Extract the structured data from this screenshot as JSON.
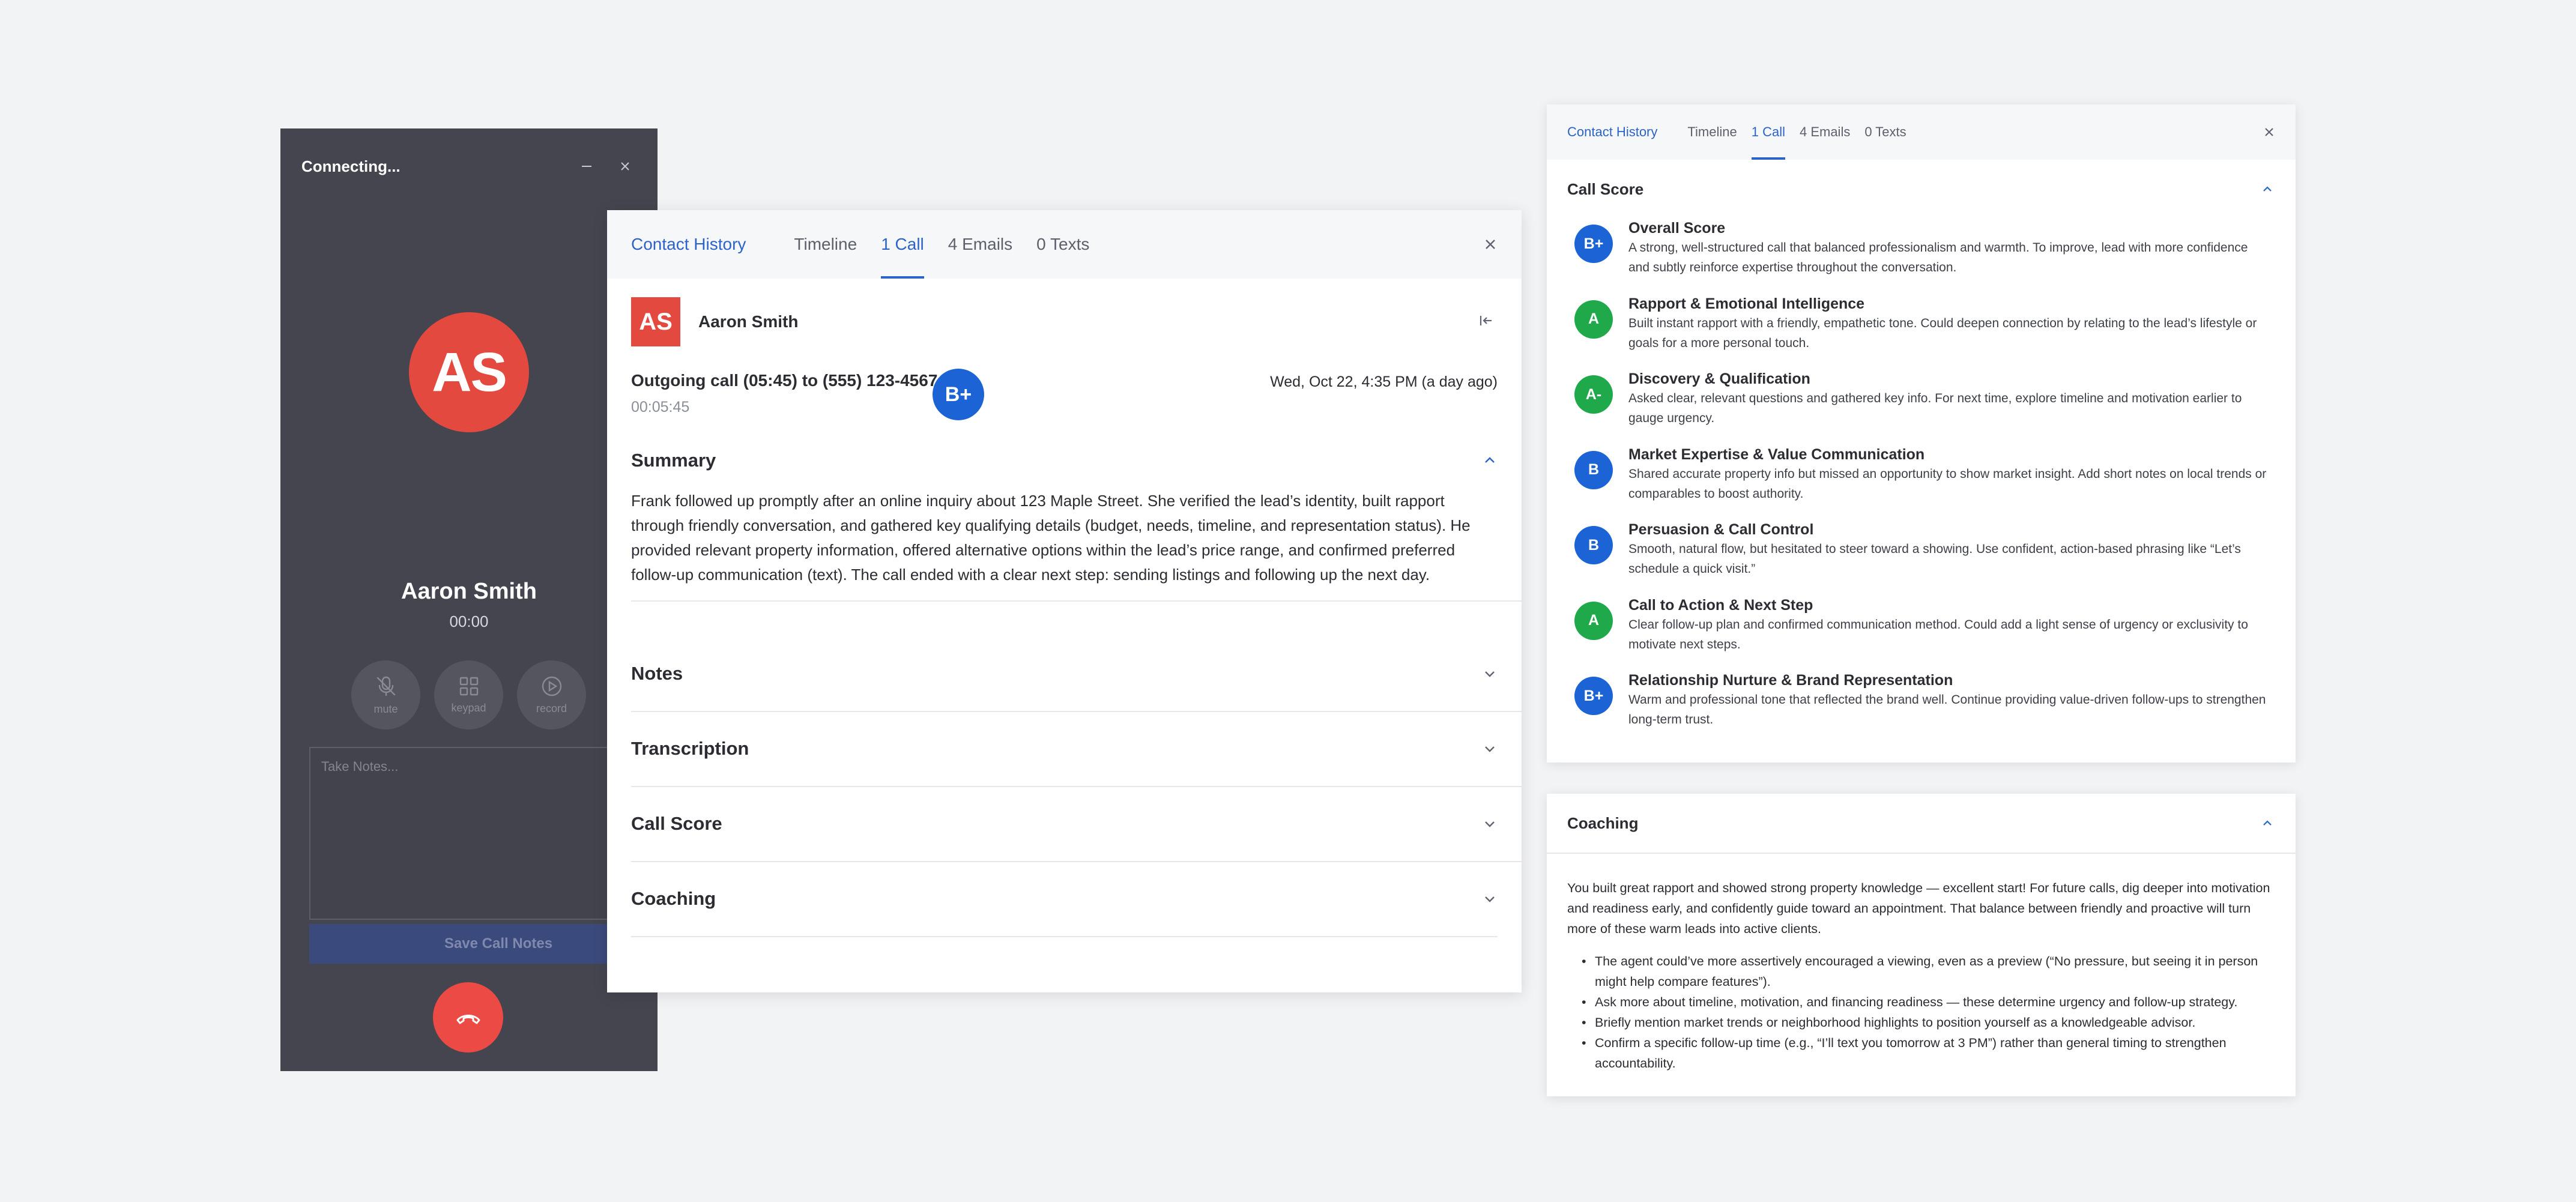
{
  "dialer": {
    "title": "Connecting...",
    "initials": "AS",
    "name": "Aaron Smith",
    "timer": "00:00",
    "buttons": [
      {
        "label": "mute",
        "icon": "mic-off-icon"
      },
      {
        "label": "keypad",
        "icon": "keypad-icon"
      },
      {
        "label": "record",
        "icon": "record-icon"
      }
    ],
    "notes_placeholder": "Take Notes...",
    "save_label": "Save Call Notes",
    "colors": {
      "background": "#454550",
      "avatar": "#e4493f",
      "hangup": "#ec4a45"
    }
  },
  "contact_history": {
    "tabs": {
      "brand": "Contact History",
      "timeline": "Timeline",
      "call": "1 Call",
      "emails": "4 Emails",
      "texts": "0 Texts"
    },
    "contact": {
      "initials": "AS",
      "name": "Aaron Smith"
    },
    "call": {
      "description": "Outgoing call (05:45) to (555) 123-4567",
      "duration": "00:05:45",
      "grade": "B+",
      "date": "Wed, Oct 22, 4:35 PM (a day ago)"
    },
    "sections": {
      "summary": {
        "title": "Summary",
        "text": "Frank followed up promptly after an online inquiry about 123 Maple Street. She verified the lead’s identity, built rapport through friendly conversation, and gathered key qualifying details (budget, needs, timeline, and representation status). He provided relevant property information, offered alternative options within the lead’s price range, and confirmed preferred follow-up communication (text). The call ended with a clear next step: sending listings and following up the next day."
      },
      "notes": "Notes",
      "transcription": "Transcription",
      "call_score": "Call Score",
      "coaching": "Coaching"
    },
    "accent": "#2c63c9"
  },
  "call_score_panel": {
    "tabs": {
      "brand": "Contact History",
      "timeline": "Timeline",
      "call": "1 Call",
      "emails": "4 Emails",
      "texts": "0 Texts"
    },
    "title": "Call Score",
    "items": [
      {
        "grade": "B+",
        "color": "#1c63d6",
        "title": "Overall Score",
        "desc": "A strong, well-structured call that balanced professionalism and warmth. To improve, lead with more confidence and subtly reinforce expertise throughout the conversation."
      },
      {
        "grade": "A",
        "color": "#1fa94a",
        "title": "Rapport & Emotional Intelligence",
        "desc": "Built instant rapport with a friendly, empathetic tone. Could deepen connection by relating to the lead’s lifestyle or goals for a more personal touch."
      },
      {
        "grade": "A-",
        "color": "#1fa94a",
        "title": "Discovery & Qualification",
        "desc": "Asked clear, relevant questions and gathered key info. For next time, explore timeline and motivation earlier to gauge urgency."
      },
      {
        "grade": "B",
        "color": "#1c63d6",
        "title": "Market Expertise & Value Communication",
        "desc": "Shared accurate property info but missed an opportunity to show market insight. Add short notes on local trends or comparables to boost authority."
      },
      {
        "grade": "B",
        "color": "#1c63d6",
        "title": "Persuasion & Call Control",
        "desc": "Smooth, natural flow, but hesitated to steer toward a showing. Use confident, action-based phrasing like “Let’s schedule a quick visit.”"
      },
      {
        "grade": "A",
        "color": "#1fa94a",
        "title": "Call to Action & Next Step",
        "desc": "Clear follow-up plan and confirmed communication method. Could add a light sense of urgency or exclusivity to motivate next steps."
      },
      {
        "grade": "B+",
        "color": "#1c63d6",
        "title": "Relationship Nurture & Brand Representation",
        "desc": "Warm and professional tone that reflected the brand well. Continue providing value-driven follow-ups to strengthen long-term trust."
      }
    ]
  },
  "coaching_panel": {
    "title": "Coaching",
    "intro": "You built great rapport and showed strong property knowledge — excellent start! For future calls, dig deeper into motivation and readiness early, and confidently guide toward an appointment. That balance between friendly and proactive will turn more of these warm leads into active clients.",
    "bullets": [
      "The agent could’ve more assertively encouraged a viewing, even as a preview (“No pressure, but seeing it in person might help compare features”).",
      "Ask more about timeline, motivation, and financing readiness — these determine urgency and follow-up strategy.",
      "Briefly mention market trends or neighborhood highlights to position yourself as a knowledgeable advisor.",
      "Confirm a specific follow-up time (e.g., “I’ll text you tomorrow at 3 PM”) rather than general timing to strengthen accountability."
    ]
  }
}
